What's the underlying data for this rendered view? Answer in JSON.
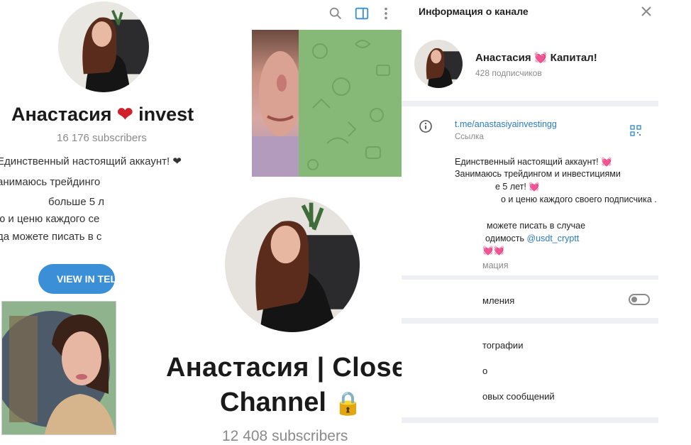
{
  "left_profile": {
    "name_part1": "Анастасия",
    "heart": "❤",
    "name_part2": "invest",
    "subscribers": "16 176 subscribers",
    "description_lines": [
      "Единственный настоящий аккаунт! ❤",
      "анимаюсь трейдинго",
      "больше 5 л",
      "ю и ценю каждого се",
      "да можете писать в с"
    ],
    "view_button": "VIEW IN TELE"
  },
  "center_profile": {
    "name_line1": "Анастасия | Closed",
    "name_line2": "Channel",
    "lock": "🔒",
    "subscribers": "12 408 subscribers"
  },
  "toolbar": {
    "icons": [
      "search-icon",
      "sidebar-toggle-icon",
      "more-vertical-icon"
    ]
  },
  "info_panel": {
    "title": "Информация о канале",
    "channel_name": "Анастасия",
    "channel_name_heart": "💓",
    "channel_name_suffix": "Капитал!",
    "subscribers": "428 подписчиков",
    "link": "t.me/anastasiyainvestingg",
    "link_caption": "Ссылка",
    "description": [
      "Единственный настоящий аккаунт! 💓",
      "Занимаюсь трейдингом и инвестициями",
      "е 5 лет! 💓",
      "о и ценю каждого своего подписчика .",
      "можете писать в случае",
      "одимость",
      "💓💓",
      "мация"
    ],
    "mention": "@usdt_cryptt",
    "rows": {
      "notifications": "мления",
      "photos": "тографии",
      "row2": "о",
      "voice": "овых сообщений"
    },
    "notifications_on": false
  },
  "colors": {
    "accent": "#3a8fd6",
    "link": "#2a7bc4",
    "pink": "#e8479a",
    "telegram_green": "#86b978"
  }
}
